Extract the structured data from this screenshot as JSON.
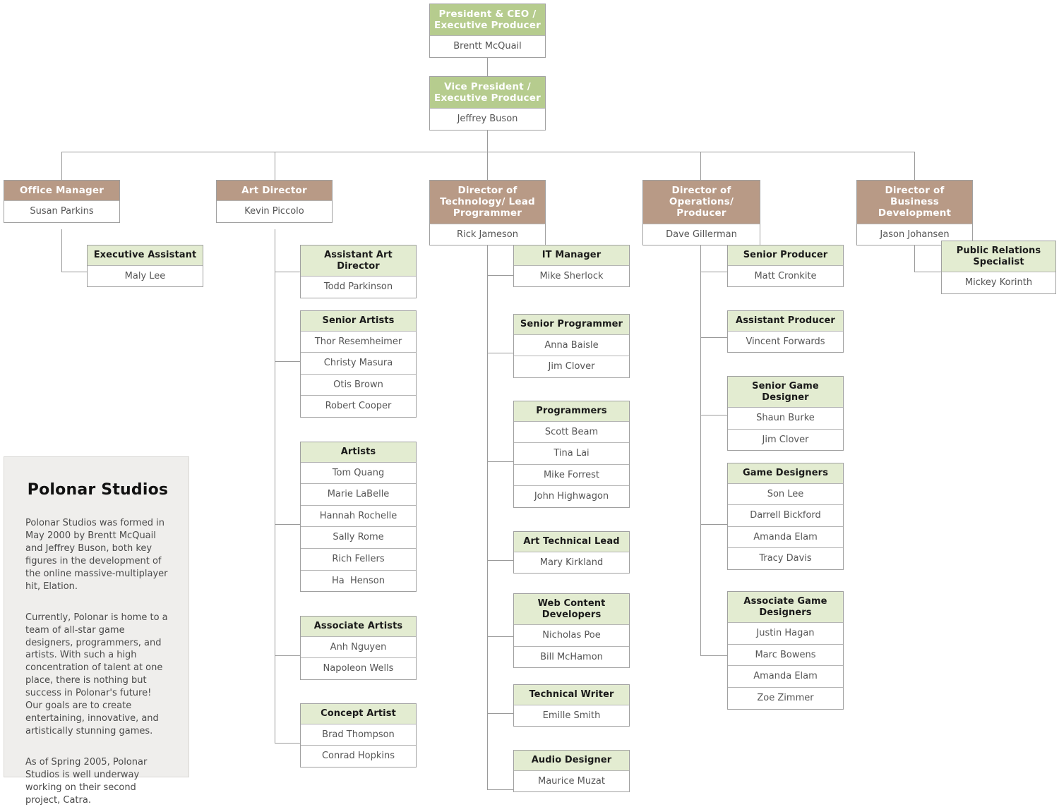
{
  "colors": {
    "top_header": "#b6cc8e",
    "director_header": "#b89a86",
    "team_header": "#e3ecd1",
    "line": "#9a9a9a",
    "panel_bg": "#efeeec"
  },
  "info_panel": {
    "title": "Polonar Studios",
    "paragraphs": [
      "Polonar Studios was formed in May 2000 by Brentt McQuail and Jeffrey Buson, both key figures in the development of the online massive-multiplayer hit, Elation.",
      "Currently, Polonar is home to a team of all-star game designers, programmers, and artists. With such a high concentration of talent at one place, there is nothing but success in Polonar's future! Our goals are to create entertaining, innovative, and artistically stunning games.",
      "As of Spring 2005, Polonar Studios is well underway working on their second project, Catra."
    ]
  },
  "nodes": {
    "ceo": {
      "title": "President & CEO /\nExecutive Producer",
      "members": [
        "Brentt McQuail"
      ]
    },
    "vp": {
      "title": "Vice President /\nExecutive Producer",
      "members": [
        "Jeffrey Buson"
      ]
    },
    "office_manager": {
      "title": "Office Manager",
      "members": [
        "Susan Parkins"
      ]
    },
    "exec_assistant": {
      "title": "Executive Assistant",
      "members": [
        "Maly Lee"
      ]
    },
    "art_director": {
      "title": "Art Director",
      "members": [
        "Kevin Piccolo"
      ]
    },
    "assistant_art_director": {
      "title": "Assistant Art Director",
      "members": [
        "Todd Parkinson"
      ]
    },
    "senior_artists": {
      "title": "Senior Artists",
      "members": [
        "Thor Resemheimer",
        "Christy Masura",
        "Otis Brown",
        "Robert Cooper"
      ]
    },
    "artists": {
      "title": "Artists",
      "members": [
        "Tom Quang",
        "Marie LaBelle",
        "Hannah Rochelle",
        "Sally Rome",
        "Rich Fellers",
        "Ha  Henson"
      ]
    },
    "associate_artists": {
      "title": "Associate Artists",
      "members": [
        "Anh Nguyen",
        "Napoleon Wells"
      ]
    },
    "concept_artist": {
      "title": "Concept Artist",
      "members": [
        "Brad Thompson",
        "Conrad Hopkins"
      ]
    },
    "director_technology": {
      "title": "Director of\nTechnology/ Lead\nProgrammer",
      "members": [
        "Rick Jameson"
      ]
    },
    "it_manager": {
      "title": "IT Manager",
      "members": [
        "Mike Sherlock"
      ]
    },
    "senior_programmer": {
      "title": "Senior Programmer",
      "members": [
        "Anna Baisle",
        "Jim Clover"
      ]
    },
    "programmers": {
      "title": "Programmers",
      "members": [
        "Scott Beam",
        "Tina Lai",
        "Mike Forrest",
        "John Highwagon"
      ]
    },
    "art_technical_lead": {
      "title": "Art Technical Lead",
      "members": [
        "Mary Kirkland"
      ]
    },
    "web_content_developers": {
      "title": "Web Content\nDevelopers",
      "members": [
        "Nicholas Poe",
        "Bill McHamon"
      ]
    },
    "technical_writer": {
      "title": "Technical Writer",
      "members": [
        "Emille Smith"
      ]
    },
    "audio_designer": {
      "title": "Audio Designer",
      "members": [
        "Maurice Muzat"
      ]
    },
    "director_operations": {
      "title": "Director of\nOperations/ Producer",
      "members": [
        "Dave Gillerman"
      ]
    },
    "senior_producer": {
      "title": "Senior Producer",
      "members": [
        "Matt Cronkite"
      ]
    },
    "assistant_producer": {
      "title": "Assistant Producer",
      "members": [
        "Vincent Forwards"
      ]
    },
    "senior_game_designer": {
      "title": "Senior Game Designer",
      "members": [
        "Shaun Burke",
        "Jim Clover"
      ]
    },
    "game_designers": {
      "title": "Game Designers",
      "members": [
        "Son Lee",
        "Darrell Bickford",
        "Amanda Elam",
        "Tracy Davis"
      ]
    },
    "associate_game_designers": {
      "title": "Associate Game\nDesigners",
      "members": [
        "Justin Hagan",
        "Marc Bowens",
        "Amanda Elam",
        "Zoe Zimmer"
      ]
    },
    "director_business": {
      "title": "Director of Business\nDevelopment",
      "members": [
        "Jason Johansen"
      ]
    },
    "public_relations": {
      "title": "Public Relations\nSpecialist",
      "members": [
        "Mickey Korinth"
      ]
    }
  }
}
